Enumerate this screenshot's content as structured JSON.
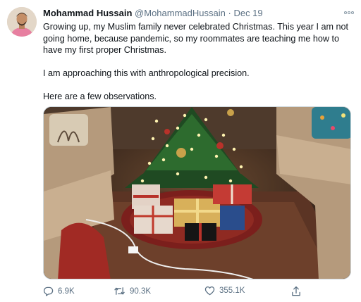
{
  "author": {
    "display_name": "Mohammad Hussain",
    "handle": "@MohammadHussain",
    "separator": "·",
    "date": "Dec 19"
  },
  "tweet": {
    "paragraphs": [
      "Growing up, my Muslim family never celebrated Christmas. This year I am not going home, because pandemic, so my roommates are teaching me how to have my first proper Christmas.",
      "I am approaching this with anthropological precision.",
      "Here are a few observations."
    ]
  },
  "media": {
    "subject": "christmas-tree-photo"
  },
  "actions": {
    "replies": "6.9K",
    "retweets": "90.3K",
    "likes": "355.1K"
  },
  "icons": {
    "more": "more-icon",
    "reply": "reply-icon",
    "retweet": "retweet-icon",
    "like": "heart-icon",
    "share": "share-icon"
  },
  "colors": {
    "text": "#0f1419",
    "secondary": "#5b7083",
    "border": "#cfd9de"
  }
}
